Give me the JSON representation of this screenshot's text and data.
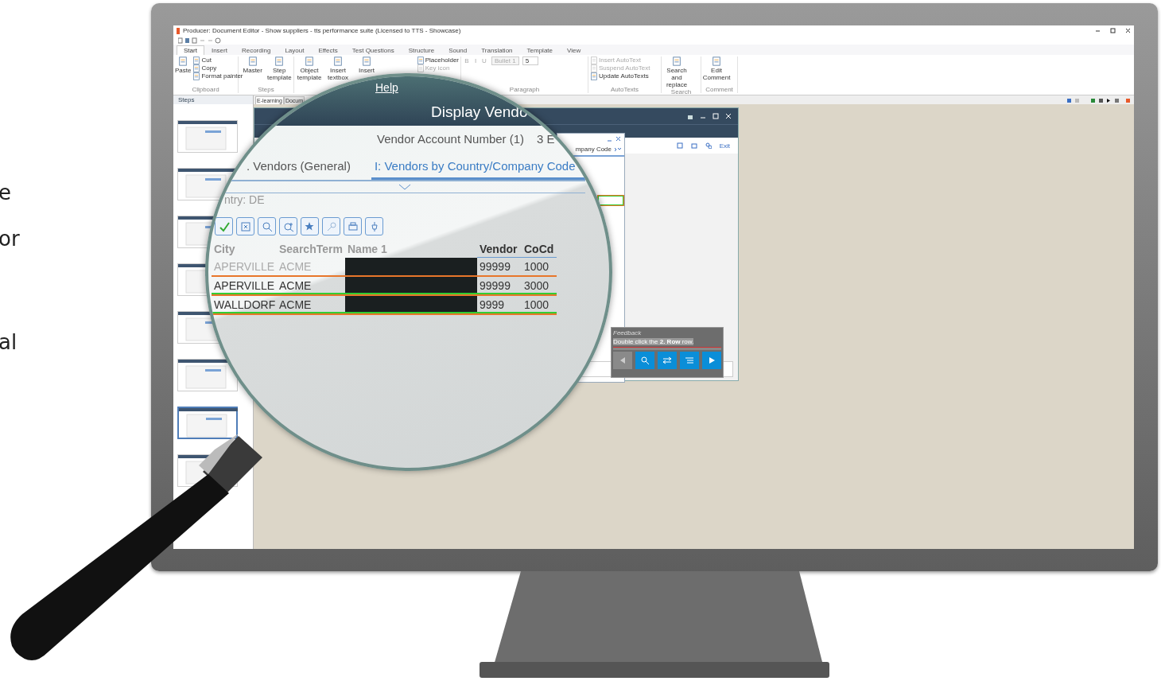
{
  "side_text": [
    "e",
    "or",
    "al"
  ],
  "app": {
    "title": "Producer: Document Editor - Show suppliers - tts performance suite (Licensed to TTS - Showcase)",
    "ribbon_tabs": [
      {
        "label": "Start",
        "selected": true
      },
      {
        "label": "Insert",
        "selected": false
      },
      {
        "label": "Recording",
        "selected": false
      },
      {
        "label": "Layout",
        "selected": false
      },
      {
        "label": "Effects",
        "selected": false
      },
      {
        "label": "Test Questions",
        "selected": false
      },
      {
        "label": "Structure",
        "selected": false
      },
      {
        "label": "Sound",
        "selected": false
      },
      {
        "label": "Translation",
        "selected": false
      },
      {
        "label": "Template",
        "selected": false
      },
      {
        "label": "View",
        "selected": false
      }
    ],
    "ribbon_groups": [
      {
        "label": "Clipboard",
        "items": [
          {
            "kind": "large",
            "label": "Paste",
            "disabled": false
          },
          {
            "kind": "small",
            "label": "Cut",
            "disabled": false
          },
          {
            "kind": "small",
            "label": "Copy",
            "disabled": false
          },
          {
            "kind": "small",
            "label": "Format painter",
            "disabled": false
          }
        ]
      },
      {
        "label": "Steps",
        "items": [
          {
            "kind": "large",
            "label": "Master",
            "disabled": false
          },
          {
            "kind": "large",
            "label": "Step template",
            "disabled": false
          }
        ]
      },
      {
        "items": [
          {
            "kind": "large",
            "label": "Object template",
            "disabled": false
          },
          {
            "kind": "large",
            "label": "Insert textbox",
            "disabled": false
          },
          {
            "kind": "large",
            "label": "Insert",
            "disabled": false
          },
          {
            "kind": "small",
            "label": "Placeholder",
            "disabled": false
          },
          {
            "kind": "small",
            "label": "Key icon",
            "disabled": true
          }
        ]
      },
      {
        "label": "Paragraph",
        "items": [
          {
            "kind": "format",
            "label": "B",
            "disabled": true
          },
          {
            "kind": "format",
            "label": "I",
            "disabled": true
          },
          {
            "kind": "format",
            "label": "U",
            "disabled": true
          },
          {
            "kind": "dropdown",
            "label": "Bullet 1",
            "disabled": true
          },
          {
            "kind": "dropdown",
            "label": "5",
            "disabled": false
          }
        ]
      },
      {
        "label": "AutoTexts",
        "items": [
          {
            "kind": "small",
            "label": "Insert AutoText",
            "disabled": true
          },
          {
            "kind": "small",
            "label": "Suspend AutoText",
            "disabled": true
          },
          {
            "kind": "small",
            "label": "Update AutoTexts",
            "disabled": false
          }
        ]
      },
      {
        "label": "Search",
        "items": [
          {
            "kind": "large",
            "label": "Search and replace",
            "disabled": false
          }
        ]
      },
      {
        "label": "Comment",
        "items": [
          {
            "kind": "large",
            "label": "Edit Comment",
            "disabled": false
          }
        ]
      }
    ],
    "steps_panel": {
      "title": "Steps",
      "thumbnails": [
        {
          "selected": false
        },
        {
          "selected": false
        },
        {
          "selected": false
        },
        {
          "selected": false
        },
        {
          "selected": false
        },
        {
          "selected": false
        },
        {
          "selected": true
        },
        {
          "selected": false
        }
      ]
    },
    "doc_tabs": [
      {
        "label": "E-learning",
        "selected": true
      },
      {
        "label": "Docum",
        "selected": false
      }
    ],
    "sap": {
      "toolbar_exit": "Exit",
      "popup_tab": "mpany Code",
      "feedback": {
        "title": "Feedback",
        "instruction": "Double click the **2. Row** row.",
        "buttons": [
          {
            "kind": "back",
            "disabled": true
          },
          {
            "kind": "action",
            "disabled": false
          },
          {
            "kind": "swap",
            "disabled": false
          },
          {
            "kind": "list",
            "disabled": false
          },
          {
            "kind": "play",
            "disabled": false
          }
        ]
      }
    }
  },
  "lens": {
    "menu": "Help",
    "title": "Display Vendo",
    "account_label": "Vendor Account Number (1)",
    "account_value": "3 E",
    "tabs": [
      {
        "label": ". Vendors (General)",
        "selected": false
      },
      {
        "label": "I: Vendors by Country/Company Code",
        "selected": true
      }
    ],
    "filter": "ntry: DE",
    "columns": [
      "City",
      "SearchTerm",
      "Name 1",
      "Vendor",
      "CoCd"
    ],
    "rows": [
      {
        "city": "APERVILLE",
        "search_term": "ACME",
        "vendor": "99999",
        "cocd": "1000",
        "selected": true
      },
      {
        "city": "APERVILLE",
        "search_term": "ACME",
        "vendor": "99999",
        "cocd": "3000",
        "selected": false
      },
      {
        "city": "WALLDORF",
        "search_term": "ACME",
        "vendor": "9999",
        "cocd": "1000",
        "selected": false
      }
    ]
  }
}
